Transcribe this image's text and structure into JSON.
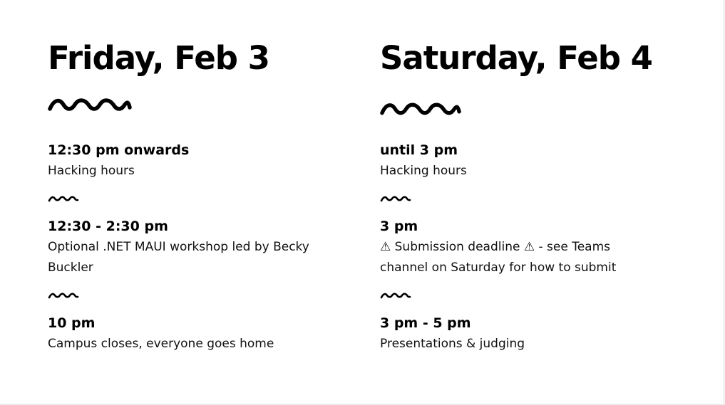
{
  "friday": {
    "title": "Friday, Feb 3",
    "events": [
      {
        "time": "12:30 pm onwards",
        "description": "Hacking hours"
      },
      {
        "time": "12:30 - 2:30 pm",
        "description": "Optional .NET MAUI workshop led by Becky Buckler"
      },
      {
        "time": "10 pm",
        "description": "Campus closes, everyone goes home"
      }
    ]
  },
  "saturday": {
    "title": "Saturday, Feb 4",
    "events": [
      {
        "time": "until 3 pm",
        "description": "Hacking hours"
      },
      {
        "time": "3 pm",
        "description": "⚠ Submission deadline ⚠ - see Teams channel on Saturday for how to submit"
      },
      {
        "time": "3 pm - 5 pm",
        "description": "Presentations & judging"
      }
    ]
  },
  "icons": {
    "divider": "squiggle-divider-icon"
  },
  "colors": {
    "text": "#000000",
    "background": "#ffffff"
  }
}
